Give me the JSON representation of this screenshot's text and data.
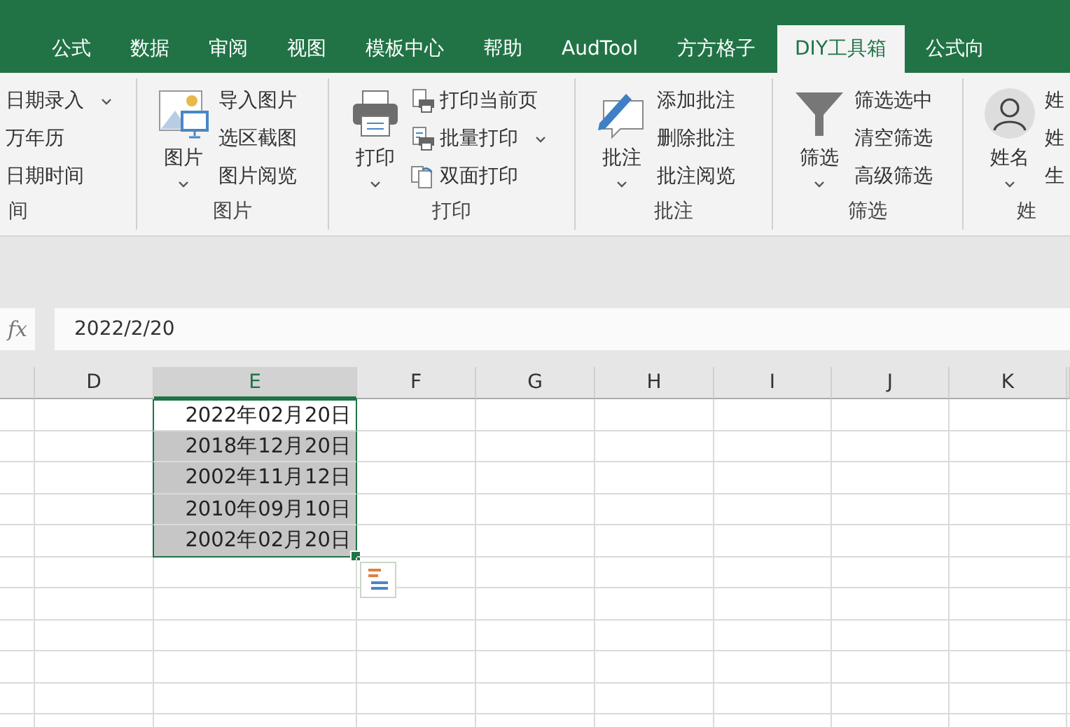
{
  "ribbon": {
    "tabs": [
      {
        "label": "公式",
        "selected": false
      },
      {
        "label": "数据",
        "selected": false
      },
      {
        "label": "审阅",
        "selected": false
      },
      {
        "label": "视图",
        "selected": false
      },
      {
        "label": "模板中心",
        "selected": false
      },
      {
        "label": "帮助",
        "selected": false
      },
      {
        "label": "AudTool",
        "selected": false
      },
      {
        "label": "方方格子",
        "selected": false
      },
      {
        "label": "DIY工具箱",
        "selected": true
      },
      {
        "label": "公式向",
        "selected": false
      }
    ],
    "groups": [
      {
        "label": "间",
        "items": [
          {
            "label": "日期录入",
            "menu": true
          },
          {
            "label": "万年历",
            "menu": false
          },
          {
            "label": "日期时间",
            "menu": false
          }
        ]
      },
      {
        "label": "图片",
        "large": {
          "label": "图片",
          "menu": true
        },
        "items": [
          {
            "label": "导入图片",
            "menu": false
          },
          {
            "label": "选区截图",
            "menu": false
          },
          {
            "label": "图片阅览",
            "menu": false
          }
        ]
      },
      {
        "label": "打印",
        "large": {
          "label": "打印",
          "menu": true
        },
        "items": [
          {
            "label": "打印当前页",
            "menu": false
          },
          {
            "label": "批量打印",
            "menu": true
          },
          {
            "label": "双面打印",
            "menu": false
          }
        ]
      },
      {
        "label": "批注",
        "large": {
          "label": "批注",
          "menu": true
        },
        "items": [
          {
            "label": "添加批注",
            "menu": false
          },
          {
            "label": "删除批注",
            "menu": false
          },
          {
            "label": "批注阅览",
            "menu": false
          }
        ]
      },
      {
        "label": "筛选",
        "large": {
          "label": "筛选",
          "menu": true
        },
        "items": [
          {
            "label": "筛选选中",
            "menu": false
          },
          {
            "label": "清空筛选",
            "menu": false
          },
          {
            "label": "高级筛选",
            "menu": false
          }
        ]
      },
      {
        "label": "姓",
        "large": {
          "label": "姓名",
          "menu": true
        },
        "items": [
          {
            "label": "姓",
            "menu": false
          },
          {
            "label": "姓",
            "menu": false
          },
          {
            "label": "生",
            "menu": false
          }
        ]
      }
    ]
  },
  "formula_bar": {
    "fx": "fx",
    "value": "2022/2/20"
  },
  "sheet": {
    "columns": [
      {
        "label": "D",
        "selected": false
      },
      {
        "label": "E",
        "selected": true
      },
      {
        "label": "F",
        "selected": false
      },
      {
        "label": "G",
        "selected": false
      },
      {
        "label": "H",
        "selected": false
      },
      {
        "label": "I",
        "selected": false
      },
      {
        "label": "J",
        "selected": false
      },
      {
        "label": "K",
        "selected": false
      }
    ],
    "cells": [
      {
        "text": "2022年02月20日",
        "selected": true,
        "active": true
      },
      {
        "text": "2018年12月20日",
        "selected": true,
        "active": false
      },
      {
        "text": "2002年11月12日",
        "selected": true,
        "active": false
      },
      {
        "text": "2010年09月10日",
        "selected": true,
        "active": false
      },
      {
        "text": "2002年02月20日",
        "selected": true,
        "active": false
      }
    ]
  }
}
